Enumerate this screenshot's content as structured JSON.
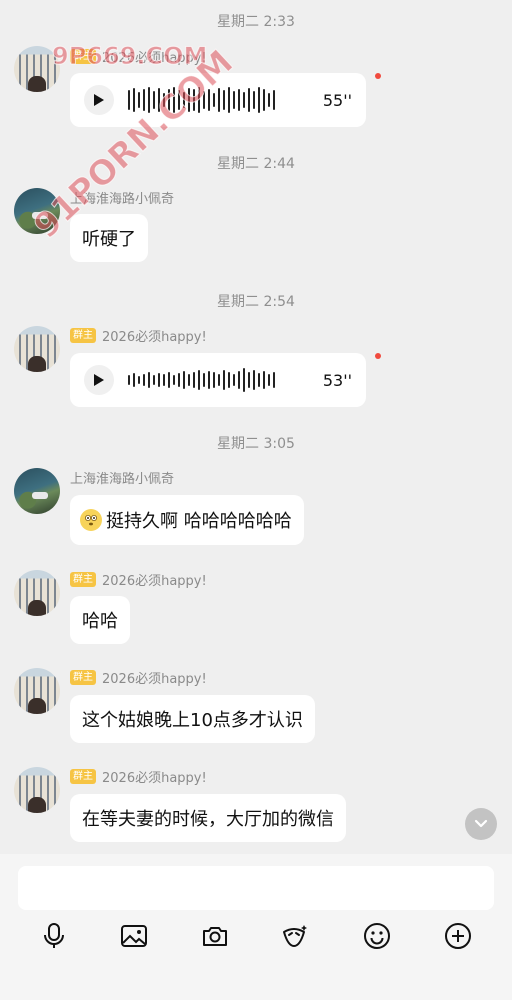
{
  "watermarks": {
    "top": "9P669.COM",
    "diagonal": "91PORN.COM"
  },
  "colors": {
    "badge": "#f6c444",
    "unread_dot": "#f04a3e",
    "bubble": "#ffffff",
    "background": "#efefef"
  },
  "messages": [
    {
      "kind": "time",
      "text": "星期二 2:33"
    },
    {
      "kind": "voice",
      "sender": "2026必须happy!",
      "badge": "群主",
      "duration": "55''",
      "unread": true
    },
    {
      "kind": "time",
      "text": "星期二 2:44"
    },
    {
      "kind": "text",
      "sender": "上海淮海路小佩奇",
      "text": "听硬了"
    },
    {
      "kind": "time",
      "text": "星期二 2:54"
    },
    {
      "kind": "voice",
      "sender": "2026必须happy!",
      "badge": "群主",
      "duration": "53''",
      "unread": true
    },
    {
      "kind": "time",
      "text": "星期二 3:05"
    },
    {
      "kind": "text",
      "sender": "上海淮海路小佩奇",
      "text": "挺持久啊 哈哈哈哈哈哈",
      "emoji": "flushed-face-icon"
    },
    {
      "kind": "text",
      "sender": "2026必须happy!",
      "badge": "群主",
      "text": "哈哈"
    },
    {
      "kind": "text",
      "sender": "2026必须happy!",
      "badge": "群主",
      "text": "这个姑娘晚上10点多才认识"
    },
    {
      "kind": "text",
      "sender": "2026必须happy!",
      "badge": "群主",
      "text": "在等夫妻的时候，大厅加的微信"
    }
  ],
  "toolbar": [
    {
      "icon": "microphone-icon"
    },
    {
      "icon": "image-icon"
    },
    {
      "icon": "camera-icon"
    },
    {
      "icon": "sticker-icon"
    },
    {
      "icon": "emoji-icon"
    },
    {
      "icon": "plus-icon"
    }
  ]
}
